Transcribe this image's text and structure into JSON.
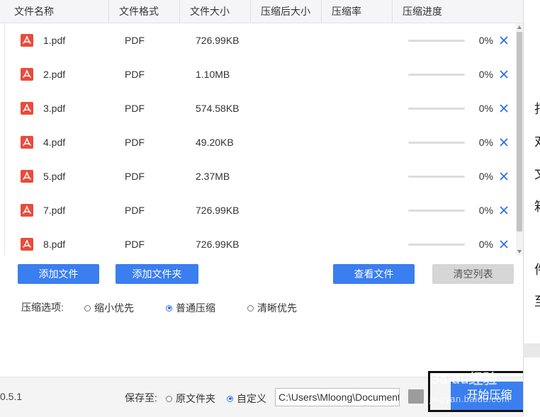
{
  "columns": [
    "文件名称",
    "文件格式",
    "文件大小",
    "压缩后大小",
    "压缩率",
    "压缩进度"
  ],
  "files": [
    {
      "name": "1.pdf",
      "format": "PDF",
      "size": "726.99KB",
      "compressed_size": "",
      "ratio": "",
      "progress": 0,
      "progress_text": "0%"
    },
    {
      "name": "2.pdf",
      "format": "PDF",
      "size": "1.10MB",
      "compressed_size": "",
      "ratio": "",
      "progress": 0,
      "progress_text": "0%"
    },
    {
      "name": "3.pdf",
      "format": "PDF",
      "size": "574.58KB",
      "compressed_size": "",
      "ratio": "",
      "progress": 0,
      "progress_text": "0%"
    },
    {
      "name": "4.pdf",
      "format": "PDF",
      "size": "49.20KB",
      "compressed_size": "",
      "ratio": "",
      "progress": 0,
      "progress_text": "0%"
    },
    {
      "name": "5.pdf",
      "format": "PDF",
      "size": "2.37MB",
      "compressed_size": "",
      "ratio": "",
      "progress": 0,
      "progress_text": "0%"
    },
    {
      "name": "7.pdf",
      "format": "PDF",
      "size": "726.99KB",
      "compressed_size": "",
      "ratio": "",
      "progress": 0,
      "progress_text": "0%"
    },
    {
      "name": "8.pdf",
      "format": "PDF",
      "size": "726.99KB",
      "compressed_size": "",
      "ratio": "",
      "progress": 0,
      "progress_text": "0%"
    }
  ],
  "buttons": {
    "add_file": "添加文件",
    "add_folder": "添加文件夹",
    "view_file": "查看文件",
    "clear_list": "清空列表",
    "start": "开始压缩"
  },
  "compression": {
    "label": "压缩选项:",
    "options": [
      {
        "label": "缩小优先",
        "selected": false
      },
      {
        "label": "普通压缩",
        "selected": true
      },
      {
        "label": "清晰优先",
        "selected": false
      }
    ]
  },
  "footer": {
    "version": "0.5.1",
    "save_label": "保存至:",
    "save_options": [
      {
        "label": "原文件夹",
        "selected": false
      },
      {
        "label": "自定义",
        "selected": true
      }
    ],
    "path": "C:\\Users\\Mloong\\Documents"
  },
  "watermark": {
    "line1": "Baidu经验",
    "line2": "jingyan.baidu.com"
  },
  "background_text": [
    "打",
    "对",
    "文",
    "箱",
    "件",
    "至"
  ],
  "colors": {
    "accent": "#3a7ef0",
    "pdf_red": "#e84c3d",
    "close_blue": "#2f6fe0",
    "gray_button": "#d6d6d6"
  }
}
